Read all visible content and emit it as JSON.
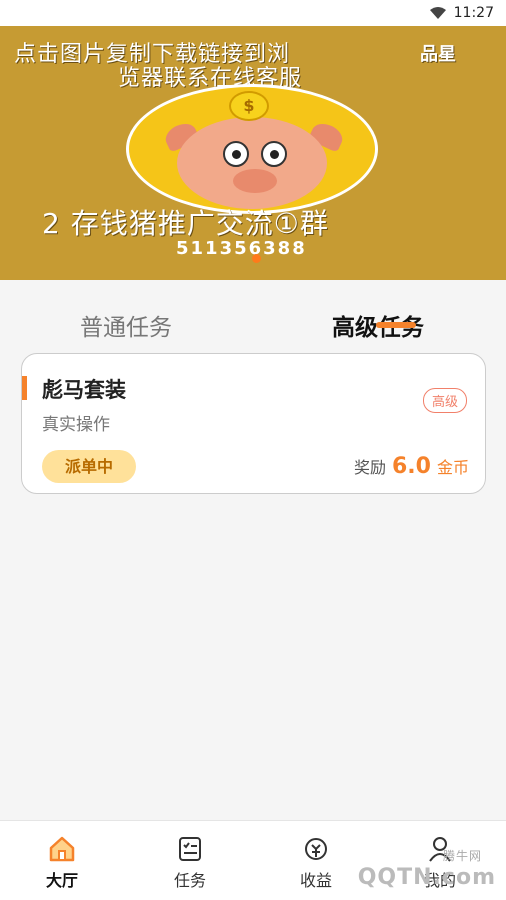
{
  "status_bar": {
    "time": "11:27"
  },
  "banner": {
    "line1": "点击图片复制下载链接到浏",
    "line2": "览器联系在线客服",
    "qr_text": "品星",
    "group_text": "2 存钱猪推广交流①群",
    "number": "511356388",
    "coin_symbol": "$"
  },
  "tabs": {
    "normal_label": "普通任务",
    "advanced_label": "高级任务"
  },
  "task_card": {
    "title": "彪马套装",
    "subtitle": "真实操作",
    "badge": "高级",
    "status": "派单中",
    "reward_label": "奖励",
    "reward_value": "6.0",
    "reward_unit": "金币"
  },
  "bottom_nav": {
    "items": [
      {
        "label": "大厅",
        "icon": "home-icon",
        "active": true
      },
      {
        "label": "任务",
        "icon": "task-list-icon",
        "active": false
      },
      {
        "label": "收益",
        "icon": "earnings-icon",
        "active": false
      },
      {
        "label": "我的",
        "icon": "profile-icon",
        "active": false
      }
    ]
  },
  "watermark": {
    "main": "QQTN.com",
    "sub": "腾牛网"
  },
  "colors": {
    "accent": "#f5822b",
    "banner": "#c69b33"
  }
}
